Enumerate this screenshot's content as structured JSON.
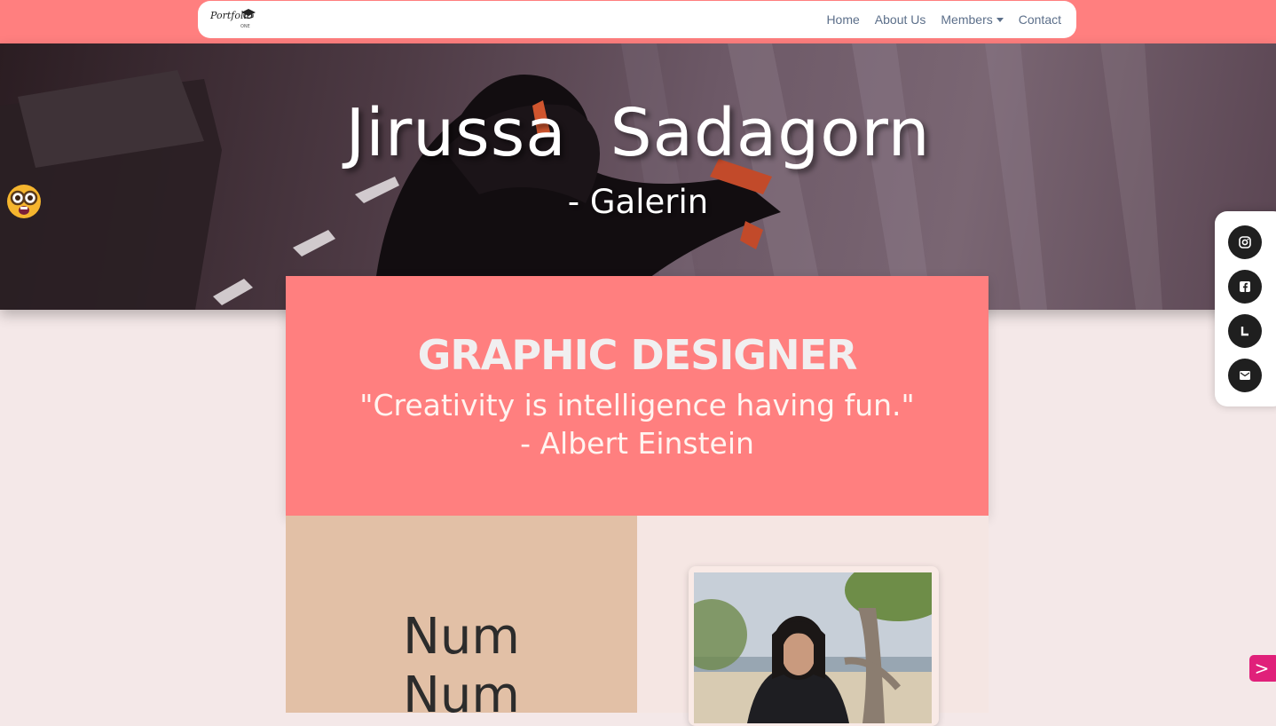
{
  "navbar": {
    "logo_text": "Portfolio",
    "logo_sub": "ONE",
    "links": [
      {
        "label": "Home"
      },
      {
        "label": "About Us"
      },
      {
        "label": "Members",
        "has_dropdown": true
      },
      {
        "label": "Contact"
      }
    ]
  },
  "hero": {
    "name": "Jirussa  Sadagorn",
    "nickname": "- Galerin",
    "emoji_icon": "nerd-face-icon"
  },
  "profile": {
    "role": "GRAPHIC DESIGNER",
    "quote_line1": "\"Creativity is intelligence having fun.\"",
    "quote_line2": "- Albert Einstein",
    "nick_line1": "Num",
    "nick_line2": "Num"
  },
  "social": [
    {
      "name": "instagram-icon"
    },
    {
      "name": "facebook-icon"
    },
    {
      "name": "line-icon"
    },
    {
      "name": "email-icon"
    }
  ],
  "next_button": ">",
  "colors": {
    "accent": "#ff7f7f",
    "page_bg": "#f4e8e8",
    "card_left": "#e2c0a6",
    "card_right": "#f5e6e3",
    "next_button": "#e0207a",
    "nav_link": "#5c6f8a"
  }
}
